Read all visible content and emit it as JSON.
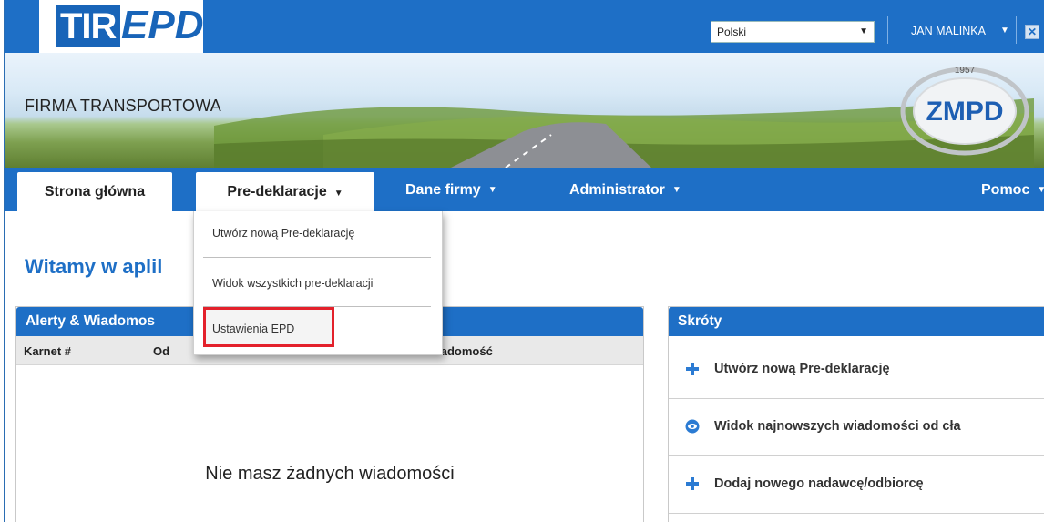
{
  "header": {
    "logo_tir": "TIR",
    "logo_epd": "EPD",
    "language": "Polski",
    "user": "JAN MALINKA",
    "company": "FIRMA TRANSPORTOWA",
    "zmpd_year": "1957",
    "zmpd_logo": "ZMPD"
  },
  "nav": {
    "home": "Strona główna",
    "predeclarations": "Pre-deklaracje",
    "company_data": "Dane firmy",
    "administrator": "Administrator",
    "help": "Pomoc"
  },
  "dropdown": {
    "items": [
      "Utwórz nową Pre-deklarację",
      "Widok wszystkich pre-deklaracji",
      "Ustawienia EPD"
    ]
  },
  "main": {
    "welcome": "Witamy w aplil"
  },
  "alerts": {
    "title": "Alerty & Wiadomos",
    "columns": [
      "Karnet #",
      "Od",
      "wiadomość"
    ],
    "empty": "Nie masz żadnych wiadomości"
  },
  "shortcuts": {
    "title": "Skróty",
    "items": [
      {
        "icon": "plus-icon",
        "label": "Utwórz nową Pre-deklarację"
      },
      {
        "icon": "eye-icon",
        "label": "Widok najnowszych wiadomości od cła"
      },
      {
        "icon": "plus-icon",
        "label": "Dodaj nowego nadawcę/odbiorcę"
      }
    ]
  },
  "colors": {
    "primary": "#1e6fc6",
    "highlight": "#e3212b"
  }
}
